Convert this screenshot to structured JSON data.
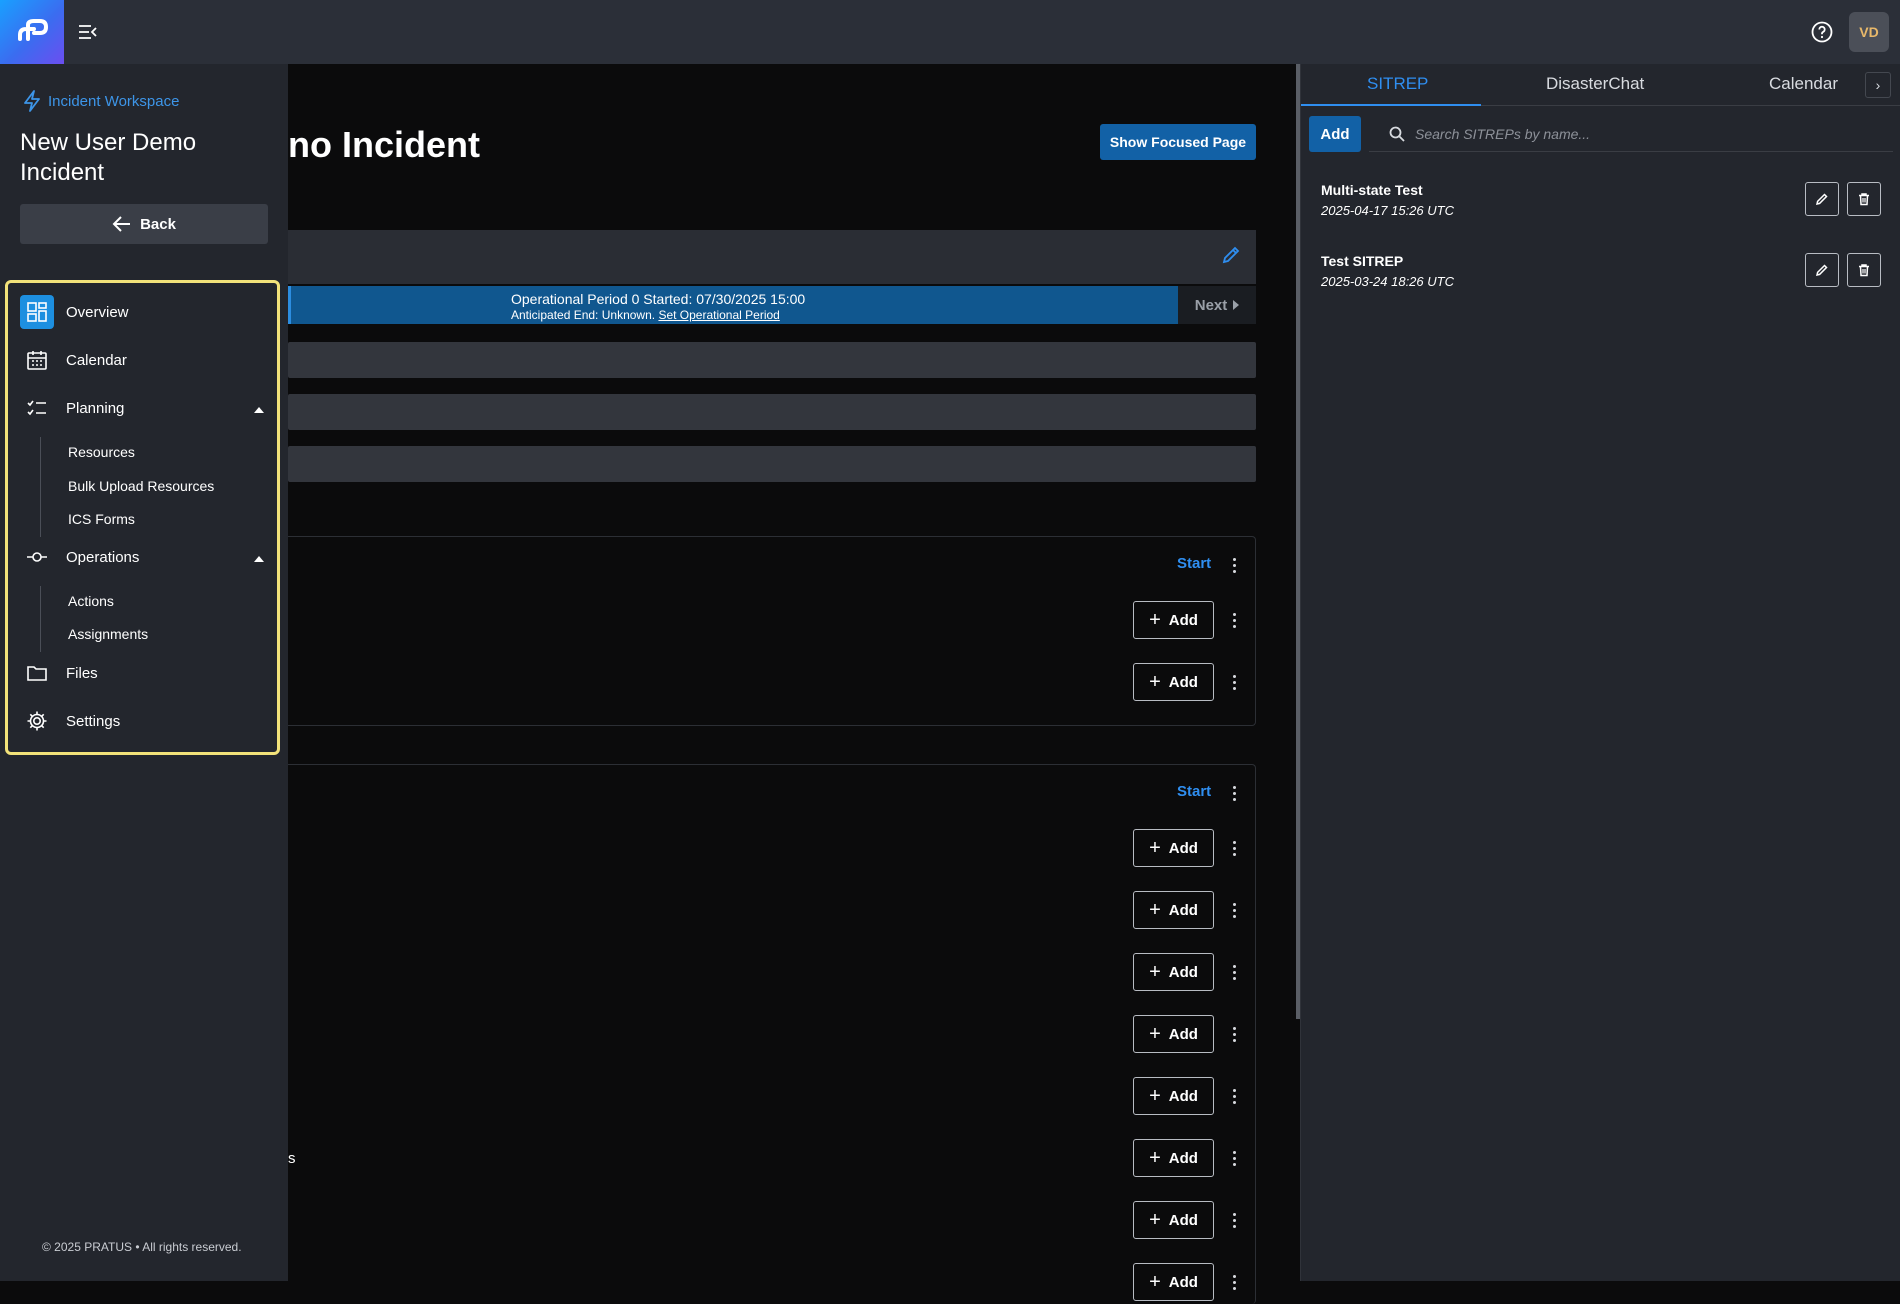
{
  "topbar": {
    "logo_icon": "pratus-logo-icon",
    "menu_icon": "menu-collapse-icon",
    "help_icon": "help-circle-icon",
    "avatar_initials": "VD"
  },
  "sidebar": {
    "workspace_link": "Incident Workspace",
    "incident_title": "New User Demo Incident",
    "back_label": "Back",
    "nav": {
      "overview": "Overview",
      "calendar": "Calendar",
      "planning": "Planning",
      "planning_items": [
        "Resources",
        "Bulk Upload Resources",
        "ICS Forms"
      ],
      "operations": "Operations",
      "operations_items": [
        "Actions",
        "Assignments"
      ],
      "files": "Files",
      "settings": "Settings"
    },
    "copyright": "© 2025 PRATUS • All rights reserved."
  },
  "main": {
    "title_fragment": "no Incident",
    "focus_button": "Show Focused Page",
    "op_period": {
      "line1": "Operational Period 0 Started: 07/30/2025 15:00",
      "line2_prefix": "Anticipated End: Unknown.",
      "line2_link": "Set Operational Period",
      "next_label": "Next"
    },
    "card1": {
      "start_label": "Start",
      "add_label": "Add"
    },
    "card2": {
      "start_label": "Start",
      "add_label": "Add"
    },
    "text_fragment": "s"
  },
  "right_panel": {
    "tabs": [
      "SITREP",
      "DisasterChat",
      "Calendar"
    ],
    "active_tab": "SITREP",
    "add_label": "Add",
    "search_placeholder": "Search SITREPs by name...",
    "sitreps": [
      {
        "name": "Multi-state Test",
        "date": "2025-04-17 15:26 UTC"
      },
      {
        "name": "Test SITREP",
        "date": "2025-03-24 18:26 UTC"
      }
    ]
  },
  "colors": {
    "accent": "#2f8ef0",
    "primary_button": "#1261a6",
    "highlight_border": "#f2e27a",
    "avatar_text": "#e8b86a"
  }
}
